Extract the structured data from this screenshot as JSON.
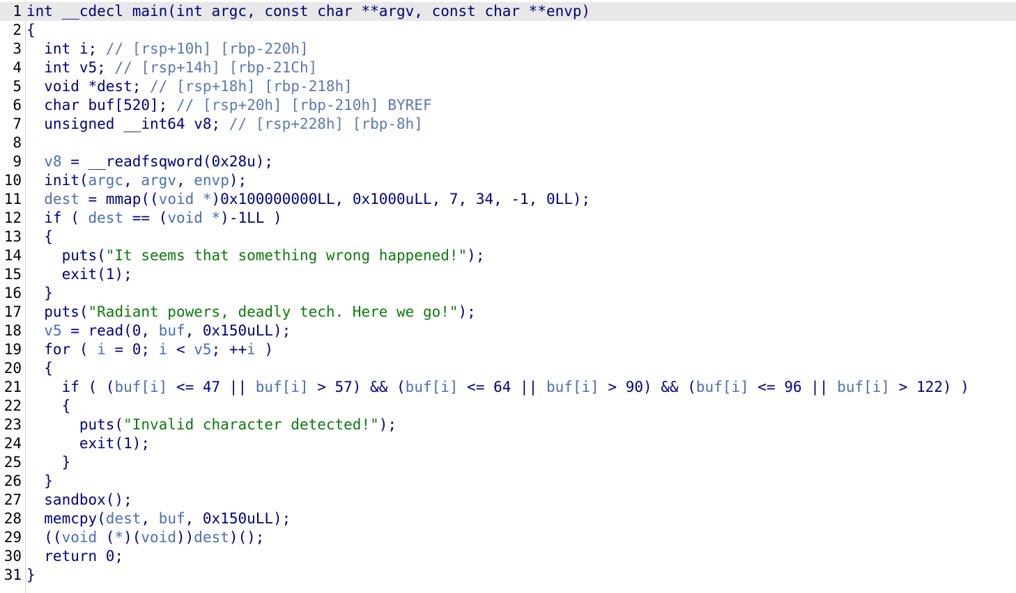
{
  "editor": {
    "lines": [
      {
        "num": "1",
        "segs": [
          {
            "t": "int __cdecl main(int argc, const char **argv, const char **envp)",
            "c": "c-kw"
          }
        ]
      },
      {
        "num": "2",
        "segs": [
          {
            "t": "{",
            "c": "c-kw"
          }
        ]
      },
      {
        "num": "3",
        "segs": [
          {
            "t": "  int i; ",
            "c": "c-kw"
          },
          {
            "t": "// [rsp+10h] [rbp-220h]",
            "c": "c-cmt"
          }
        ]
      },
      {
        "num": "4",
        "segs": [
          {
            "t": "  int v5; ",
            "c": "c-kw"
          },
          {
            "t": "// [rsp+14h] [rbp-21Ch]",
            "c": "c-cmt"
          }
        ]
      },
      {
        "num": "5",
        "segs": [
          {
            "t": "  void *dest; ",
            "c": "c-kw"
          },
          {
            "t": "// [rsp+18h] [rbp-218h]",
            "c": "c-cmt"
          }
        ]
      },
      {
        "num": "6",
        "segs": [
          {
            "t": "  char buf[520]; ",
            "c": "c-kw"
          },
          {
            "t": "// [rsp+20h] [rbp-210h] BYREF",
            "c": "c-cmt"
          }
        ]
      },
      {
        "num": "7",
        "segs": [
          {
            "t": "  unsigned __int64 v8; ",
            "c": "c-kw"
          },
          {
            "t": "// [rsp+228h] [rbp-8h]",
            "c": "c-cmt"
          }
        ]
      },
      {
        "num": "8",
        "segs": [
          {
            "t": "",
            "c": "c-kw"
          }
        ]
      },
      {
        "num": "9",
        "segs": [
          {
            "t": "  ",
            "c": "c-kw"
          },
          {
            "t": "v8",
            "c": "c-var"
          },
          {
            "t": " = __readfsqword(0x28u);",
            "c": "c-kw"
          }
        ]
      },
      {
        "num": "10",
        "segs": [
          {
            "t": "  init(",
            "c": "c-kw"
          },
          {
            "t": "argc",
            "c": "c-var"
          },
          {
            "t": ", ",
            "c": "c-kw"
          },
          {
            "t": "argv",
            "c": "c-var"
          },
          {
            "t": ", ",
            "c": "c-kw"
          },
          {
            "t": "envp",
            "c": "c-var"
          },
          {
            "t": ");",
            "c": "c-kw"
          }
        ]
      },
      {
        "num": "11",
        "segs": [
          {
            "t": "  ",
            "c": "c-kw"
          },
          {
            "t": "dest",
            "c": "c-var"
          },
          {
            "t": " = mmap((",
            "c": "c-kw"
          },
          {
            "t": "void *",
            "c": "c-var"
          },
          {
            "t": ")0x100000000LL, 0x1000uLL, 7, 34, -1, 0LL);",
            "c": "c-kw"
          }
        ]
      },
      {
        "num": "12",
        "segs": [
          {
            "t": "  if ( ",
            "c": "c-kw"
          },
          {
            "t": "dest",
            "c": "c-var"
          },
          {
            "t": " == (",
            "c": "c-kw"
          },
          {
            "t": "void *",
            "c": "c-var"
          },
          {
            "t": ")-1LL )",
            "c": "c-kw"
          }
        ]
      },
      {
        "num": "13",
        "segs": [
          {
            "t": "  {",
            "c": "c-kw"
          }
        ]
      },
      {
        "num": "14",
        "segs": [
          {
            "t": "    puts(",
            "c": "c-kw"
          },
          {
            "t": "\"It seems that something wrong happened!\"",
            "c": "c-str"
          },
          {
            "t": ");",
            "c": "c-kw"
          }
        ]
      },
      {
        "num": "15",
        "segs": [
          {
            "t": "    exit(1);",
            "c": "c-kw"
          }
        ]
      },
      {
        "num": "16",
        "segs": [
          {
            "t": "  }",
            "c": "c-kw"
          }
        ]
      },
      {
        "num": "17",
        "segs": [
          {
            "t": "  puts(",
            "c": "c-kw"
          },
          {
            "t": "\"Radiant powers, deadly tech. Here we go!\"",
            "c": "c-str"
          },
          {
            "t": ");",
            "c": "c-kw"
          }
        ]
      },
      {
        "num": "18",
        "segs": [
          {
            "t": "  ",
            "c": "c-kw"
          },
          {
            "t": "v5",
            "c": "c-var"
          },
          {
            "t": " = read(0, ",
            "c": "c-kw"
          },
          {
            "t": "buf",
            "c": "c-var"
          },
          {
            "t": ", 0x150uLL);",
            "c": "c-kw"
          }
        ]
      },
      {
        "num": "19",
        "segs": [
          {
            "t": "  for ( ",
            "c": "c-kw"
          },
          {
            "t": "i",
            "c": "c-var"
          },
          {
            "t": " = 0; ",
            "c": "c-kw"
          },
          {
            "t": "i",
            "c": "c-var"
          },
          {
            "t": " < ",
            "c": "c-kw"
          },
          {
            "t": "v5",
            "c": "c-var"
          },
          {
            "t": "; ++",
            "c": "c-kw"
          },
          {
            "t": "i",
            "c": "c-var"
          },
          {
            "t": " )",
            "c": "c-kw"
          }
        ]
      },
      {
        "num": "20",
        "segs": [
          {
            "t": "  {",
            "c": "c-kw"
          }
        ]
      },
      {
        "num": "21",
        "segs": [
          {
            "t": "    if ( (",
            "c": "c-kw"
          },
          {
            "t": "buf[i]",
            "c": "c-var"
          },
          {
            "t": " <= 47 || ",
            "c": "c-kw"
          },
          {
            "t": "buf[i]",
            "c": "c-var"
          },
          {
            "t": " > 57) && (",
            "c": "c-kw"
          },
          {
            "t": "buf[i]",
            "c": "c-var"
          },
          {
            "t": " <= 64 || ",
            "c": "c-kw"
          },
          {
            "t": "buf[i]",
            "c": "c-var"
          },
          {
            "t": " > 90) && (",
            "c": "c-kw"
          },
          {
            "t": "buf[i]",
            "c": "c-var"
          },
          {
            "t": " <= 96 || ",
            "c": "c-kw"
          },
          {
            "t": "buf[i]",
            "c": "c-var"
          },
          {
            "t": " > 122) )",
            "c": "c-kw"
          }
        ]
      },
      {
        "num": "22",
        "segs": [
          {
            "t": "    {",
            "c": "c-kw"
          }
        ]
      },
      {
        "num": "23",
        "segs": [
          {
            "t": "      puts(",
            "c": "c-kw"
          },
          {
            "t": "\"Invalid character detected!\"",
            "c": "c-str"
          },
          {
            "t": ");",
            "c": "c-kw"
          }
        ]
      },
      {
        "num": "24",
        "segs": [
          {
            "t": "      exit(1);",
            "c": "c-kw"
          }
        ]
      },
      {
        "num": "25",
        "segs": [
          {
            "t": "    }",
            "c": "c-kw"
          }
        ]
      },
      {
        "num": "26",
        "segs": [
          {
            "t": "  }",
            "c": "c-kw"
          }
        ]
      },
      {
        "num": "27",
        "segs": [
          {
            "t": "  sandbox();",
            "c": "c-kw"
          }
        ]
      },
      {
        "num": "28",
        "segs": [
          {
            "t": "  memcpy(",
            "c": "c-kw"
          },
          {
            "t": "dest",
            "c": "c-var"
          },
          {
            "t": ", ",
            "c": "c-kw"
          },
          {
            "t": "buf",
            "c": "c-var"
          },
          {
            "t": ", 0x150uLL);",
            "c": "c-kw"
          }
        ]
      },
      {
        "num": "29",
        "segs": [
          {
            "t": "  ((",
            "c": "c-kw"
          },
          {
            "t": "void",
            "c": "c-var"
          },
          {
            "t": " (",
            "c": "c-kw"
          },
          {
            "t": "*",
            "c": "c-var"
          },
          {
            "t": ")(",
            "c": "c-kw"
          },
          {
            "t": "void",
            "c": "c-var"
          },
          {
            "t": "))",
            "c": "c-kw"
          },
          {
            "t": "dest",
            "c": "c-var"
          },
          {
            "t": ")();",
            "c": "c-kw"
          }
        ]
      },
      {
        "num": "30",
        "segs": [
          {
            "t": "  return 0;",
            "c": "c-kw"
          }
        ]
      },
      {
        "num": "31",
        "segs": [
          {
            "t": "}",
            "c": "c-kw"
          }
        ]
      }
    ]
  },
  "colors": {
    "keyword": "#000080",
    "variable": "#4a6fb5",
    "comment": "#5a78b0",
    "string": "#0b7a0b",
    "current_line": "#e8e8e8"
  }
}
